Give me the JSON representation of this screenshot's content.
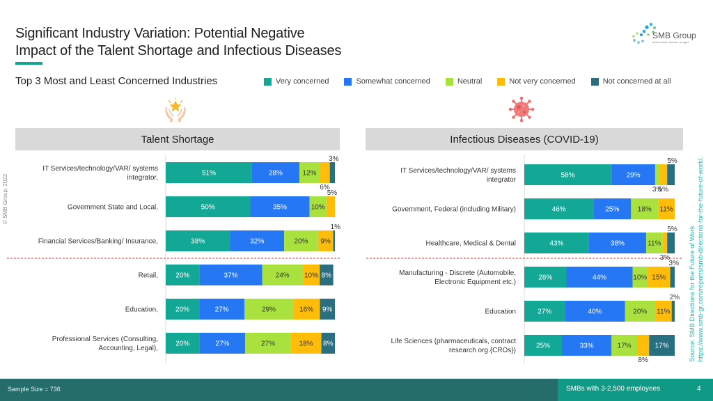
{
  "slide": {
    "title_line1": "Significant Industry Variation: Potential Negative",
    "title_line2": "Impact of the Talent Shortage and Infectious Diseases",
    "subtitle": "Top 3 Most and Least Concerned Industries",
    "copyright": "© SMB Group, 2022",
    "source_line1": "Source: SMB Directions for the Future of Work",
    "source_line2": "https://www.smb-gr.com/reports/smb-directions-for-the-future-of-work/.",
    "logo_name": "SMB Group",
    "logo_tagline": "Actionable Market Insight",
    "footer_left": "Sample Size = 736",
    "footer_right": "SMBs with 3-2,500 employees",
    "page_number": "4"
  },
  "icons": {
    "talent": "hands-holding-star-icon",
    "covid": "virus-icon",
    "logo": "smb-group-logo-icon"
  },
  "colors": {
    "very_concerned": "#13a896",
    "somewhat_concerned": "#2577f3",
    "neutral": "#a9e23f",
    "not_very_concerned": "#ffbd0a",
    "not_concerned_at_all": "#296f80",
    "divider": "#e03030"
  },
  "chart_data": [
    {
      "type": "bar",
      "orientation": "horizontal",
      "stacked": true,
      "title": "Talent Shortage",
      "xlabel": "",
      "ylabel": "",
      "xlim": [
        0,
        100
      ],
      "legend": "top",
      "grid": false,
      "categories": [
        "IT Services/technology/VAR/ systems integrator,",
        "Government State and Local,",
        "Financial Services/Banking/ Insurance,",
        "Retail,",
        "Education,",
        "Professional Services (Consulting, Accounting, Legal),"
      ],
      "category_lines": [
        [
          "IT Services/technology/VAR/ systems",
          "integrator,"
        ],
        [
          "Government State and Local,"
        ],
        [
          "Financial Services/Banking/ Insurance,"
        ],
        [
          "Retail,"
        ],
        [
          "Education,"
        ],
        [
          "Professional Services (Consulting,",
          "Accounting, Legal),"
        ]
      ],
      "groups": {
        "most_concerned": [
          0,
          1,
          2
        ],
        "least_concerned": [
          3,
          4,
          5
        ]
      },
      "series": [
        {
          "name": "Very concerned",
          "values": [
            51,
            50,
            38,
            20,
            20,
            20
          ]
        },
        {
          "name": "Somewhat concerned",
          "values": [
            28,
            35,
            32,
            37,
            27,
            27
          ]
        },
        {
          "name": "Neutral",
          "values": [
            12,
            10,
            20,
            24,
            29,
            27
          ]
        },
        {
          "name": "Not very concerned",
          "values": [
            6,
            5,
            9,
            10,
            16,
            18
          ]
        },
        {
          "name": "Not concerned at all",
          "values": [
            3,
            0,
            1,
            8,
            9,
            8
          ]
        }
      ]
    },
    {
      "type": "bar",
      "orientation": "horizontal",
      "stacked": true,
      "title": "Infectious Diseases (COVID-19)",
      "xlabel": "",
      "ylabel": "",
      "xlim": [
        0,
        100
      ],
      "legend": "top",
      "grid": false,
      "categories": [
        "IT Services/technology/VAR/ systems integrator",
        "Government, Federal (including Military)",
        "Healthcare, Medical & Dental",
        "Manufacturing - Discrete (Automobile, Electronic Equipment etc.)",
        "Education",
        "Life Sciences (pharmaceuticals, contract research org.{CROs})"
      ],
      "category_lines": [
        [
          "IT Services/technology/VAR/ systems",
          "integrator"
        ],
        [
          "Government, Federal (including Military)"
        ],
        [
          "Healthcare, Medical & Dental"
        ],
        [
          "Manufacturing - Discrete (Automobile,",
          "Electronic Equipment etc.)"
        ],
        [
          "Education"
        ],
        [
          "Life Sciences (pharmaceuticals, contract",
          "research org.{CROs})"
        ]
      ],
      "groups": {
        "most_concerned": [
          0,
          1,
          2
        ],
        "least_concerned": [
          3,
          4,
          5
        ]
      },
      "series": [
        {
          "name": "Very concerned",
          "values": [
            58,
            46,
            43,
            28,
            27,
            25
          ]
        },
        {
          "name": "Somewhat concerned",
          "values": [
            29,
            25,
            38,
            44,
            40,
            33
          ]
        },
        {
          "name": "Neutral",
          "values": [
            3,
            18,
            11,
            10,
            20,
            17
          ]
        },
        {
          "name": "Not very concerned",
          "values": [
            5,
            11,
            3,
            15,
            11,
            8
          ]
        },
        {
          "name": "Not concerned at all",
          "values": [
            5,
            0,
            5,
            3,
            2,
            17
          ]
        }
      ]
    }
  ]
}
